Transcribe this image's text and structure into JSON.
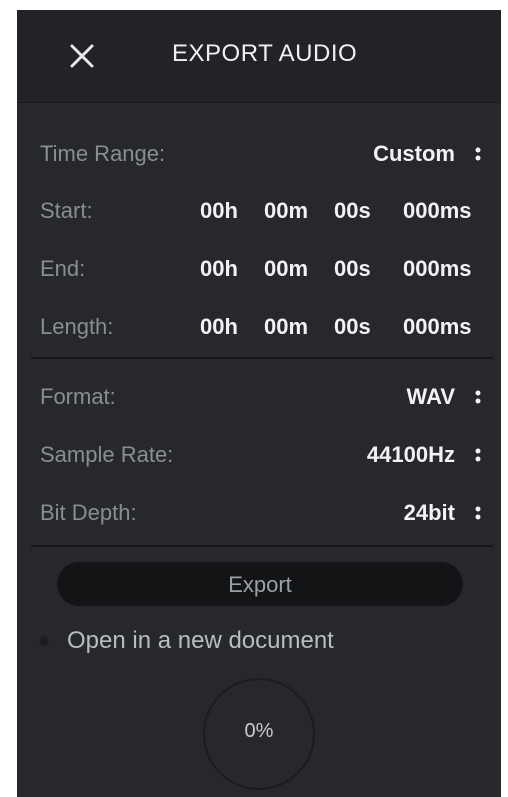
{
  "header": {
    "title": "EXPORT AUDIO",
    "close_icon": "close-icon"
  },
  "time_range": {
    "label": "Time Range:",
    "value": "Custom"
  },
  "start": {
    "label": "Start:",
    "h": "00h",
    "m": "00m",
    "s": "00s",
    "ms": "000ms"
  },
  "end": {
    "label": "End:",
    "h": "00h",
    "m": "00m",
    "s": "00s",
    "ms": "000ms"
  },
  "length": {
    "label": "Length:",
    "h": "00h",
    "m": "00m",
    "s": "00s",
    "ms": "000ms"
  },
  "format": {
    "label": "Format:",
    "value": "WAV"
  },
  "sample_rate": {
    "label": "Sample Rate:",
    "value": "44100Hz"
  },
  "bit_depth": {
    "label": "Bit Depth:",
    "value": "24bit"
  },
  "export_button": {
    "label": "Export"
  },
  "open_new_doc": {
    "label": "Open in a new document",
    "checked": false
  },
  "progress": {
    "label": "0%",
    "value": 0
  },
  "colors": {
    "panel": "#26282d",
    "header": "#212327",
    "text": "#f2f2f2",
    "muted": "#8a8d93"
  }
}
